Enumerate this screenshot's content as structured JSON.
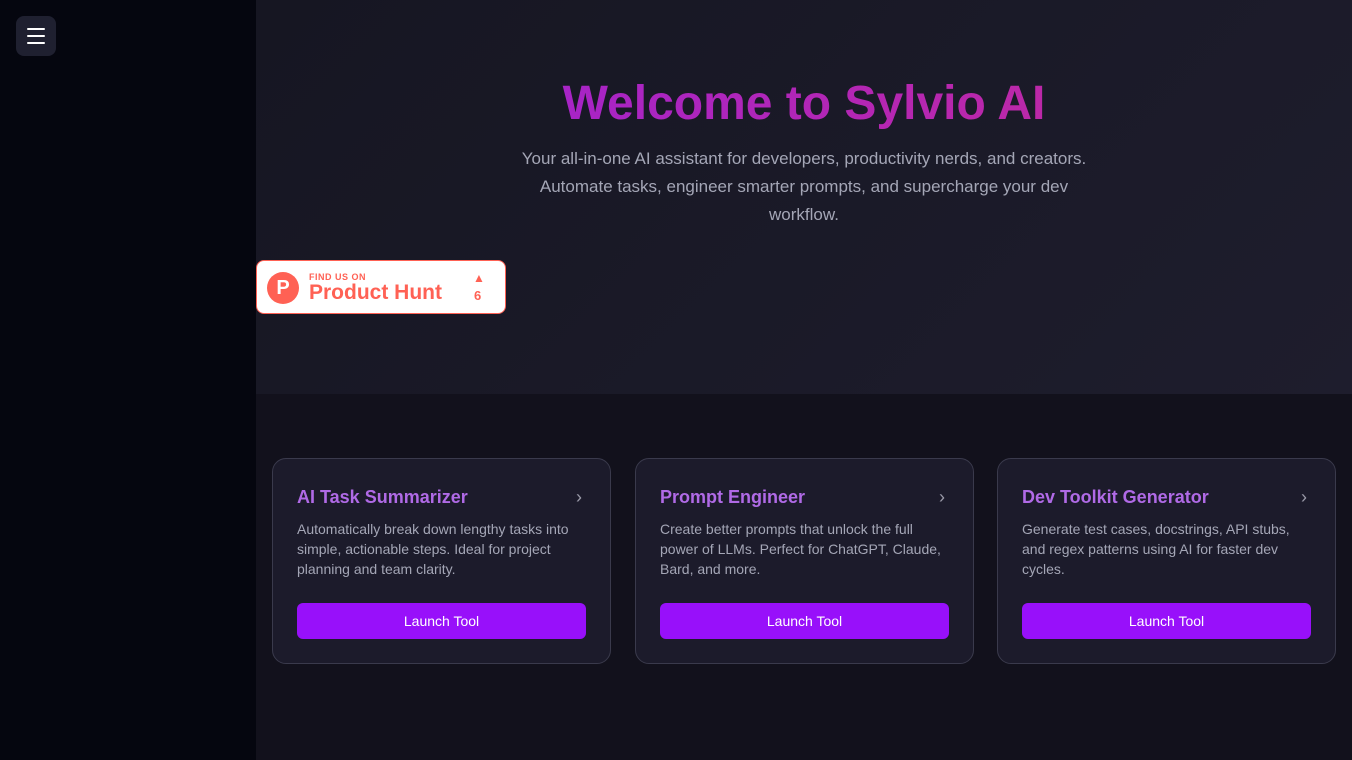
{
  "hero": {
    "title": "Welcome to Sylvio AI",
    "subtitle": "Your all-in-one AI assistant for developers, productivity nerds, and creators. Automate tasks, engineer smarter prompts, and supercharge your dev workflow."
  },
  "product_hunt": {
    "logo": "P",
    "find": "FIND US ON",
    "name": "Product Hunt",
    "upvote": "▲",
    "count": "6"
  },
  "cards": [
    {
      "title": "AI Task Summarizer",
      "desc": "Automatically break down lengthy tasks into simple, actionable steps. Ideal for project planning and team clarity.",
      "button": "Launch Tool"
    },
    {
      "title": "Prompt Engineer",
      "desc": "Create better prompts that unlock the full power of LLMs. Perfect for ChatGPT, Claude, Bard, and more.",
      "button": "Launch Tool"
    },
    {
      "title": "Dev Toolkit Generator",
      "desc": "Generate test cases, docstrings, API stubs, and regex patterns using AI for faster dev cycles.",
      "button": "Launch Tool"
    }
  ]
}
